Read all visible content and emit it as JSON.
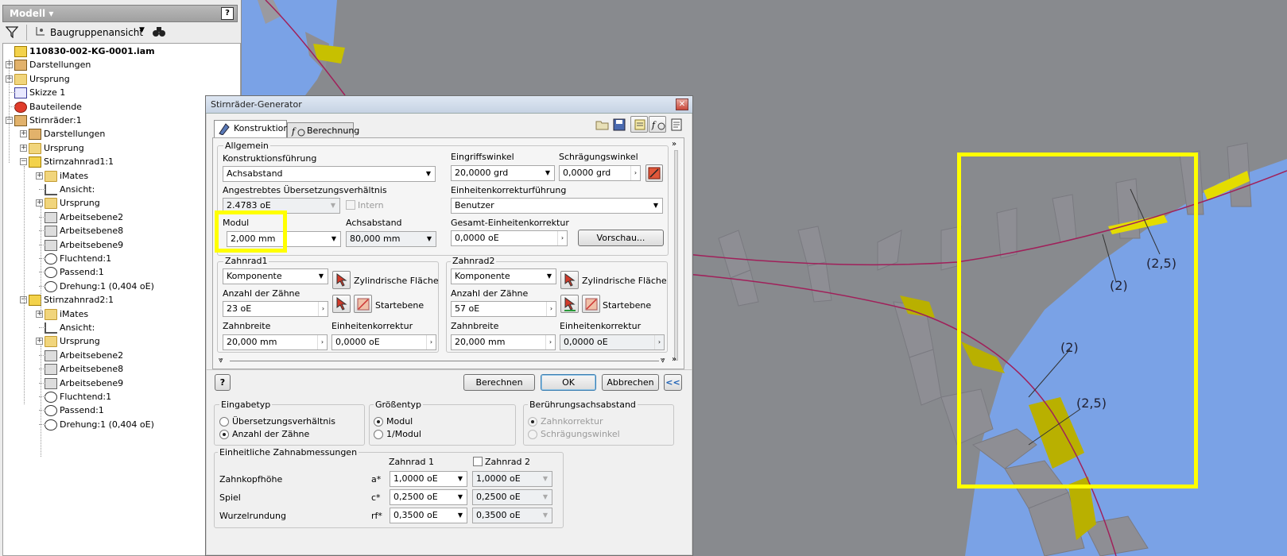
{
  "browser": {
    "title": "Modell ▾",
    "help": "?",
    "view_selector": "Baugruppenansicht",
    "tree": [
      {
        "label": "110830-002-KG-0001.iam",
        "level": 0,
        "icon": "assembly-icon",
        "bold": true,
        "exp": ""
      },
      {
        "label": "Darstellungen",
        "level": 0,
        "icon": "representations-icon",
        "exp": "+"
      },
      {
        "label": "Ursprung",
        "level": 0,
        "icon": "folder-icon",
        "exp": "+"
      },
      {
        "label": "Skizze 1",
        "level": 0,
        "icon": "sketch-icon",
        "exp": ""
      },
      {
        "label": "Bauteilende",
        "level": 0,
        "icon": "end-of-part-icon",
        "exp": ""
      },
      {
        "label": "Stirnräder:1",
        "level": 0,
        "icon": "gear-icon",
        "exp": "−"
      },
      {
        "label": "Darstellungen",
        "level": 1,
        "icon": "representations-icon",
        "exp": "+"
      },
      {
        "label": "Ursprung",
        "level": 1,
        "icon": "folder-icon",
        "exp": "+"
      },
      {
        "label": "Stirnzahnrad1:1",
        "level": 1,
        "icon": "part-icon",
        "exp": "−"
      },
      {
        "label": "iMates",
        "level": 2,
        "icon": "folder-icon",
        "exp": "+"
      },
      {
        "label": "Ansicht:",
        "level": 2,
        "icon": "view-icon",
        "exp": ""
      },
      {
        "label": "Ursprung",
        "level": 2,
        "icon": "folder-icon",
        "exp": "+"
      },
      {
        "label": "Arbeitsebene2",
        "level": 2,
        "icon": "work-plane-icon",
        "exp": ""
      },
      {
        "label": "Arbeitsebene8",
        "level": 2,
        "icon": "work-plane-icon",
        "exp": ""
      },
      {
        "label": "Arbeitsebene9",
        "level": 2,
        "icon": "work-plane-icon",
        "exp": ""
      },
      {
        "label": "Fluchtend:1",
        "level": 2,
        "icon": "flush-constraint-icon",
        "exp": ""
      },
      {
        "label": "Passend:1",
        "level": 2,
        "icon": "mate-constraint-icon",
        "exp": ""
      },
      {
        "label": "Drehung:1 (0,404 oE)",
        "level": 2,
        "icon": "rotation-constraint-icon",
        "exp": ""
      },
      {
        "label": "Stirnzahnrad2:1",
        "level": 1,
        "icon": "part-icon",
        "exp": "−"
      },
      {
        "label": "iMates",
        "level": 2,
        "icon": "folder-icon",
        "exp": "+"
      },
      {
        "label": "Ansicht:",
        "level": 2,
        "icon": "view-icon",
        "exp": ""
      },
      {
        "label": "Ursprung",
        "level": 2,
        "icon": "folder-icon",
        "exp": "+"
      },
      {
        "label": "Arbeitsebene2",
        "level": 2,
        "icon": "work-plane-icon",
        "exp": ""
      },
      {
        "label": "Arbeitsebene8",
        "level": 2,
        "icon": "work-plane-icon",
        "exp": ""
      },
      {
        "label": "Arbeitsebene9",
        "level": 2,
        "icon": "work-plane-icon",
        "exp": ""
      },
      {
        "label": "Fluchtend:1",
        "level": 2,
        "icon": "flush-constraint-icon",
        "exp": ""
      },
      {
        "label": "Passend:1",
        "level": 2,
        "icon": "mate-constraint-icon",
        "exp": ""
      },
      {
        "label": "Drehung:1 (0,404 oE)",
        "level": 2,
        "icon": "rotation-constraint-icon",
        "exp": ""
      }
    ]
  },
  "dialog": {
    "title": "Stirnräder-Generator",
    "close": "✕",
    "tabs": {
      "konstruktion": "Konstruktion",
      "berechnung": "Berechnung"
    },
    "allgemein": {
      "group": "Allgemein",
      "konstruktionsfuehrung_label": "Konstruktionsführung",
      "konstruktionsfuehrung_value": "Achsabstand",
      "uebersetzung_label": "Angestrebtes Übersetzungsverhältnis",
      "uebersetzung_value": "2.4783 oE",
      "intern_label": "Intern",
      "modul_label": "Modul",
      "modul_value": "2,000 mm",
      "achsabstand_label": "Achsabstand",
      "achsabstand_value": "80,000 mm",
      "eingriffswinkel_label": "Eingriffswinkel",
      "eingriffswinkel_value": "20,0000 grd",
      "schraegungswinkel_label": "Schrägungswinkel",
      "schraegungswinkel_value": "0,0000 grd",
      "einheitenkorrekturfuehrung_label": "Einheitenkorrekturführung",
      "einheitenkorrekturfuehrung_value": "Benutzer",
      "gesamt_label": "Gesamt-Einheitenkorrektur",
      "gesamt_value": "0,0000 oE",
      "vorschau": "Vorschau..."
    },
    "zahnrad1": {
      "group": "Zahnrad1",
      "type": "Komponente",
      "flaeche": "Zylindrische Fläche",
      "zaehne_label": "Anzahl der Zähne",
      "zaehne_value": "23 oE",
      "startebene": "Startebene",
      "breite_label": "Zahnbreite",
      "breite_value": "20,000 mm",
      "korrektur_label": "Einheitenkorrektur",
      "korrektur_value": "0,0000 oE"
    },
    "zahnrad2": {
      "group": "Zahnrad2",
      "type": "Komponente",
      "flaeche": "Zylindrische Fläche",
      "zaehne_label": "Anzahl der Zähne",
      "zaehne_value": "57 oE",
      "startebene": "Startebene",
      "breite_label": "Zahnbreite",
      "breite_value": "20,000 mm",
      "korrektur_label": "Einheitenkorrektur",
      "korrektur_value": "0,0000 oE"
    },
    "buttons": {
      "help": "?",
      "berechnen": "Berechnen",
      "ok": "OK",
      "abbrechen": "Abbrechen",
      "collapse": "<<"
    },
    "eingabetyp": {
      "group": "Eingabetyp",
      "opt1": "Übersetzungsverhältnis",
      "opt2": "Anzahl der Zähne"
    },
    "groessentyp": {
      "group": "Größentyp",
      "opt1": "Modul",
      "opt2": "1/Modul"
    },
    "beruehrung": {
      "group": "Berührungsachsabstand",
      "opt1": "Zahnkorrektur",
      "opt2": "Schrägungswinkel"
    },
    "abmessungen": {
      "group": "Einheitliche Zahnabmessungen",
      "col1": "Zahnrad 1",
      "col2": "Zahnrad 2",
      "rows": [
        {
          "label": "Zahnkopfhöhe",
          "sym": "a*",
          "v1": "1,0000 oE",
          "v2": "1,0000 oE"
        },
        {
          "label": "Spiel",
          "sym": "c*",
          "v1": "0,2500 oE",
          "v2": "0,2500 oE"
        },
        {
          "label": "Wurzelrundung",
          "sym": "rf*",
          "v1": "0,3500 oE",
          "v2": "0,3500 oE"
        }
      ]
    }
  },
  "viewport": {
    "annotations": [
      "(2,5)",
      "(2)",
      "(2)",
      "(2,5)"
    ],
    "colors": {
      "background": "#888a8e",
      "blue": "#7aa2e6",
      "tooth": "#8e8e94",
      "highlight": "#ffff00",
      "curve": "#a0205a"
    }
  }
}
